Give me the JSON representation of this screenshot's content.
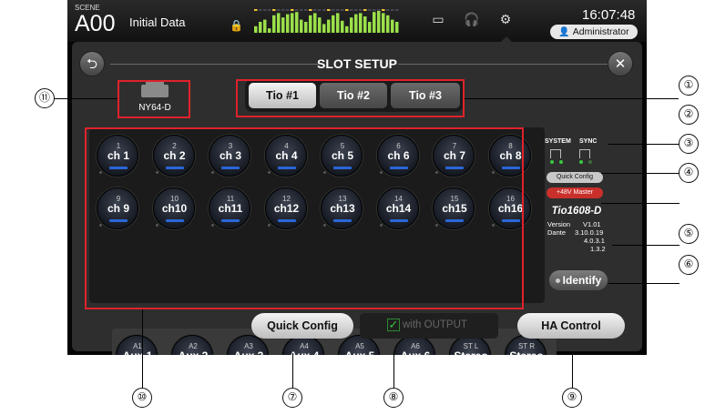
{
  "scene": {
    "label": "SCENE",
    "number": "A00",
    "name": "Initial Data"
  },
  "status": {
    "time": "16:07:48",
    "user": "Administrator"
  },
  "icons": {
    "lock": "lock-icon",
    "recorder": "recorder-icon",
    "headphones": "headphones-icon",
    "setup": "gear-icon",
    "back": "back-arrow-icon",
    "close": "close-icon",
    "user": "user-icon",
    "card": "slot-card-icon"
  },
  "dialog": {
    "title": "SLOT SETUP",
    "card_name": "NY64-D"
  },
  "tabs": [
    {
      "label": "Tio #1",
      "active": true
    },
    {
      "label": "Tio #2",
      "active": false
    },
    {
      "label": "Tio #3",
      "active": false
    }
  ],
  "channels": [
    {
      "num": "1",
      "name": "ch 1"
    },
    {
      "num": "2",
      "name": "ch 2"
    },
    {
      "num": "3",
      "name": "ch 3"
    },
    {
      "num": "4",
      "name": "ch 4"
    },
    {
      "num": "5",
      "name": "ch 5"
    },
    {
      "num": "6",
      "name": "ch 6"
    },
    {
      "num": "7",
      "name": "ch 7"
    },
    {
      "num": "8",
      "name": "ch 8"
    },
    {
      "num": "9",
      "name": "ch 9"
    },
    {
      "num": "10",
      "name": "ch10"
    },
    {
      "num": "11",
      "name": "ch11"
    },
    {
      "num": "12",
      "name": "ch12"
    },
    {
      "num": "13",
      "name": "ch13"
    },
    {
      "num": "14",
      "name": "ch14"
    },
    {
      "num": "15",
      "name": "ch15"
    },
    {
      "num": "16",
      "name": "ch16"
    }
  ],
  "outputs": [
    {
      "num": "A1",
      "name": "Aux 1",
      "color": "#e06a1e"
    },
    {
      "num": "A2",
      "name": "Aux 2",
      "color": "#e06a1e"
    },
    {
      "num": "A3",
      "name": "Aux 3",
      "color": "#e06a1e"
    },
    {
      "num": "A4",
      "name": "Aux 4",
      "color": "#e06a1e"
    },
    {
      "num": "A5",
      "name": "Aux 5",
      "color": "#e06a1e"
    },
    {
      "num": "A6",
      "name": "Aux 6",
      "color": "#e06a1e"
    },
    {
      "num": "ST L",
      "name": "Stereo",
      "color": "#d0262b"
    },
    {
      "num": "ST R",
      "name": "Stereo",
      "color": "#d0262b"
    }
  ],
  "channel_bar_color": "#2a66d8",
  "device": {
    "system_label": "SYSTEM",
    "sync_label": "SYNC",
    "quick_config_small": "Quick Config",
    "phantom_master": "+48V Master",
    "model": "Tio1608-D",
    "version_label": "Version",
    "version_value": "V1.01",
    "dante_label": "Dante",
    "dante_values": [
      "3.10.0.19",
      "4.0.3.1",
      "1.3.2"
    ],
    "identify": "Identify"
  },
  "bottom": {
    "quick_config": "Quick Config",
    "with_output": "with OUTPUT",
    "with_output_checked": true,
    "ha_control": "HA Control"
  },
  "callouts": [
    "①",
    "②",
    "③",
    "④",
    "⑤",
    "⑥",
    "⑦",
    "⑧",
    "⑨",
    "⑩",
    "⑪"
  ]
}
